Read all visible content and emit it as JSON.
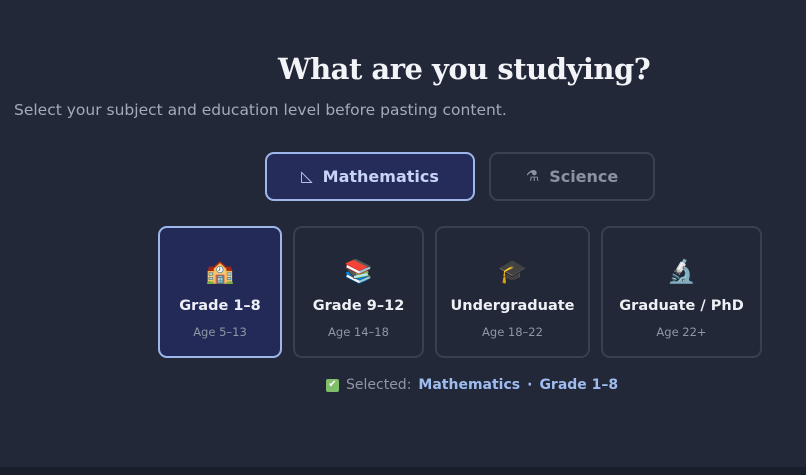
{
  "header": {
    "title": "What are you studying?",
    "subtitle": "Select your subject and education level before pasting content."
  },
  "subjects": [
    {
      "label": "Mathematics",
      "icon": "triangle-ruler-icon",
      "glyph": "◺",
      "selected": true
    },
    {
      "label": "Science",
      "icon": "microscope-icon",
      "glyph": "⚗",
      "selected": false
    }
  ],
  "levels": [
    {
      "label": "Grade 1–8",
      "age": "Age 5–13",
      "icon": "school-icon",
      "glyph": "🏫",
      "selected": true
    },
    {
      "label": "Grade 9–12",
      "age": "Age 14–18",
      "icon": "books-icon",
      "glyph": "📚",
      "selected": false
    },
    {
      "label": "Undergraduate",
      "age": "Age 18–22",
      "icon": "graduation-cap-icon",
      "glyph": "🎓",
      "selected": false
    },
    {
      "label": "Graduate / PhD",
      "age": "Age 22+",
      "icon": "microscope-icon",
      "glyph": "🔬",
      "selected": false
    }
  ],
  "status": {
    "prefix": "Selected:",
    "subject": "Mathematics",
    "separator": "·",
    "level": "Grade 1–8",
    "check_glyph": "✔"
  },
  "colors": {
    "background": "#222838",
    "accent": "#9fb6ea",
    "selected_fill": "#252c5a",
    "check": "#7fbf6a"
  }
}
